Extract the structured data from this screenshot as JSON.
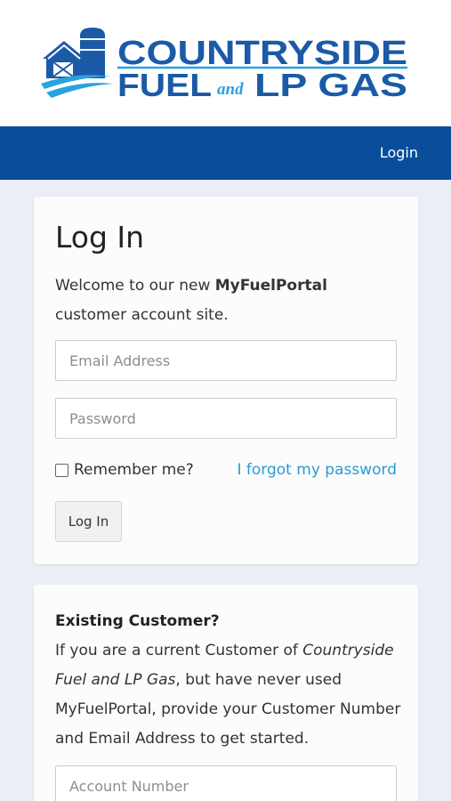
{
  "brand": {
    "line1": "COUNTRYSIDE",
    "line2_left": "FUEL",
    "line2_mid": "and",
    "line2_right": "LP GAS",
    "colors": {
      "blue": "#1b5aa7",
      "light_blue": "#29a3df"
    }
  },
  "nav": {
    "login_label": "Login",
    "bg": "#0a4e9b"
  },
  "login_card": {
    "title": "Log In",
    "welcome_prefix": "Welcome to our new",
    "welcome_brand": "MyFuelPortal",
    "welcome_suffix": "customer account site.",
    "email_placeholder": "Email Address",
    "password_placeholder": "Password",
    "remember_label": "Remember me?",
    "forgot_label": "I forgot my password",
    "submit_label": "Log In"
  },
  "existing_card": {
    "title": "Existing Customer?",
    "text_prefix": "If you are a current Customer of",
    "company": "Countryside Fuel and LP Gas",
    "text_suffix": ", but have never used MyFuelPortal, provide your Customer Number and Email Address to get started.",
    "account_placeholder": "Account Number"
  }
}
